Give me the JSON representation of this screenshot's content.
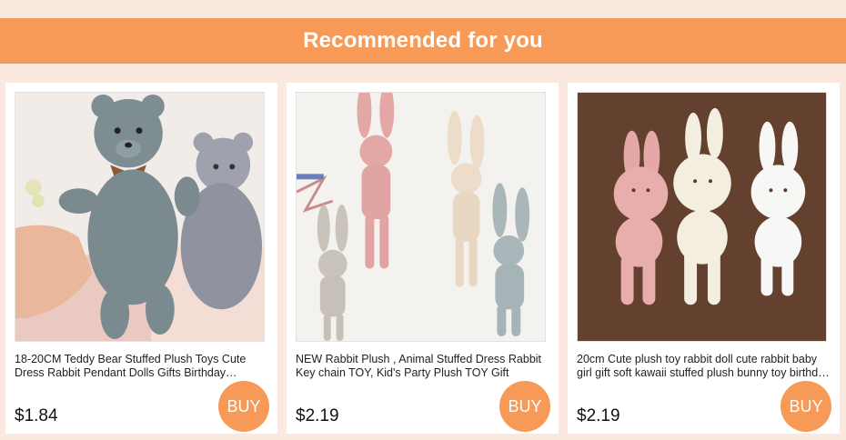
{
  "banner": {
    "title": "Recommended for you"
  },
  "colors": {
    "accent": "#f79a57",
    "page_bg": "#fbe9df"
  },
  "products": [
    {
      "title": "18-20CM Teddy Bear Stuffed Plush Toys Cute Dress Rabbit Pendant Dolls Gifts Birthday Wedding Party Decor",
      "price": "$1.84",
      "buy_label": "BUY",
      "image": "gray-knit-teddy-bears-photo"
    },
    {
      "title": "NEW Rabbit Plush , Animal Stuffed Dress Rabbit Key chain TOY, Kid's Party Plush TOY Gift",
      "price": "$2.19",
      "buy_label": "BUY",
      "image": "linen-bunny-keychains-photo"
    },
    {
      "title": "20cm Cute plush toy rabbit doll cute rabbit baby girl gift soft kawaii stuffed plush bunny toy birthday gift",
      "price": "$2.19",
      "buy_label": "BUY",
      "image": "pink-and-white-bunnies-photo"
    }
  ]
}
